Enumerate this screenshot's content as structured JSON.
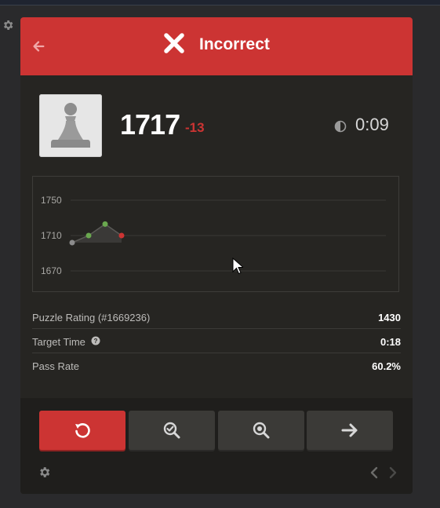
{
  "header": {
    "title": "Incorrect",
    "color": "#cc3433"
  },
  "player": {
    "rating": "1717",
    "rating_change": "-13",
    "timer": "0:09",
    "avatar_icon": "pawn-icon"
  },
  "chart_data": {
    "type": "line",
    "y_ticks": [
      "1750",
      "1710",
      "1670"
    ],
    "ylim": [
      1650,
      1770
    ],
    "x": [
      1,
      2,
      3,
      4
    ],
    "values": [
      1702,
      1710,
      1723,
      1710
    ],
    "point_colors": [
      "#8c8c8c",
      "#6aa84f",
      "#6aa84f",
      "#cc3433"
    ],
    "grid": true
  },
  "stats": [
    {
      "label": "Puzzle Rating (#1669236)",
      "value": "1430"
    },
    {
      "label": "Target Time",
      "value": "0:18"
    },
    {
      "label": "Pass Rate",
      "value": "60.2%"
    }
  ],
  "footer": {
    "buttons": [
      "retry-icon",
      "analysis-icon",
      "hint-search-icon",
      "next-arrow-icon"
    ]
  }
}
